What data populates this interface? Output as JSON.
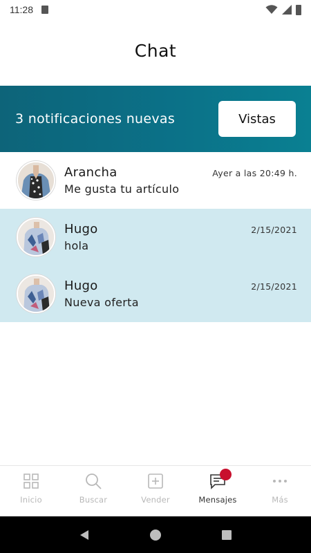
{
  "status_bar": {
    "time": "11:28",
    "icons": [
      "sd-card-icon",
      "wifi-icon",
      "signal-icon",
      "battery-icon"
    ]
  },
  "header": {
    "title": "Chat"
  },
  "notification_banner": {
    "text": "3 notificaciones nuevas",
    "button_label": "Vistas",
    "gradient_start": "#0d6479",
    "gradient_end": "#0a8092"
  },
  "chats": [
    {
      "name": "Arancha",
      "time": "Ayer a las 20:49 h.",
      "preview": "Me gusta tu artículo",
      "unread": false
    },
    {
      "name": "Hugo",
      "time": "2/15/2021",
      "preview": "hola",
      "unread": true
    },
    {
      "name": "Hugo",
      "time": "2/15/2021",
      "preview": "Nueva oferta",
      "unread": true
    }
  ],
  "colors": {
    "unread_row_bg": "#d0e9f0",
    "badge": "#c8102e"
  },
  "bottom_nav": [
    {
      "label": "Inicio",
      "icon": "grid-icon",
      "active": false
    },
    {
      "label": "Buscar",
      "icon": "search-icon",
      "active": false
    },
    {
      "label": "Vender",
      "icon": "add-box-icon",
      "active": false
    },
    {
      "label": "Mensajes",
      "icon": "chat-icon",
      "active": true,
      "badge": true
    },
    {
      "label": "Más",
      "icon": "more-dots-icon",
      "active": false
    }
  ],
  "system_nav": [
    "back-icon",
    "home-icon",
    "recents-icon"
  ]
}
